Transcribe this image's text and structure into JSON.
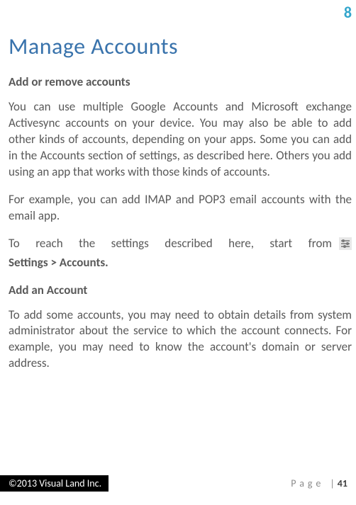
{
  "top_page_number": "8",
  "title": "Manage Accounts",
  "section1_heading": "Add or remove accounts",
  "para1": "You can use multiple Google Accounts and Microsoft exchange Activesync accounts on your device. You may also be able to add other kinds of accounts, depending on your apps. Some you can add in the Accounts section of settings, as described here. Others you add using an app that works with those kinds of accounts.",
  "para2": "For example, you can add IMAP and POP3 email accounts with the email app.",
  "para3_lead": "To reach the settings described here, start from",
  "breadcrumb": "Settings > Accounts.",
  "section2_heading": "Add an Account",
  "para4": "To add some accounts, you may need to obtain details from system administrator about the service to which the account connects. For example, you may need to know the account's domain or server address.",
  "footer": {
    "copyright": "©2013 Visual Land Inc.",
    "page_label": "Page",
    "divider": "|",
    "page_num": "41"
  },
  "icons": {
    "settings_slider": "settings-slider-icon"
  }
}
